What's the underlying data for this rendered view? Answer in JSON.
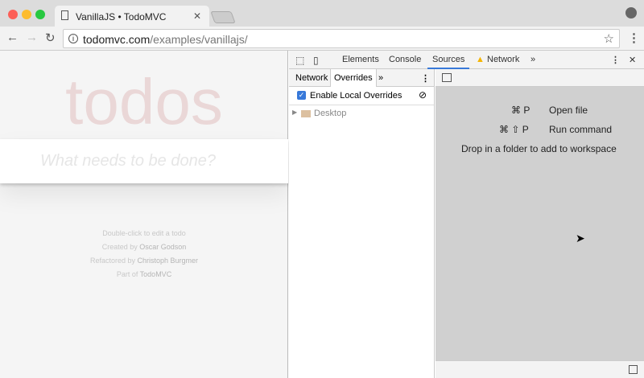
{
  "browser": {
    "tab_title": "VanillaJS • TodoMVC",
    "url_host": "todomvc.com",
    "url_path": "/examples/vanillajs/"
  },
  "page": {
    "heading": "todos",
    "placeholder": "What needs to be done?",
    "footer": {
      "hint": "Double-click to edit a todo",
      "created_prefix": "Created by ",
      "created_by": "Oscar Godson",
      "refactored_prefix": "Refactored by ",
      "refactored_by": "Christoph Burgmer",
      "part_prefix": "Part of ",
      "part_of": "TodoMVC"
    }
  },
  "devtools": {
    "tabs": [
      "Elements",
      "Console",
      "Sources",
      "Network"
    ],
    "active_tab": "Sources",
    "more": "»",
    "subtabs": [
      "Network",
      "Overrides"
    ],
    "active_subtab": "Overrides",
    "enable_overrides": "Enable Local Overrides",
    "enable_overrides_checked": true,
    "folder": "Desktop",
    "shortcuts": [
      {
        "keys": "⌘ P",
        "label": "Open file"
      },
      {
        "keys": "⌘ ⇧ P",
        "label": "Run command"
      }
    ],
    "drop_hint": "Drop in a folder to add to workspace"
  },
  "colors": {
    "accent": "#3879d9",
    "warning": "#f4b400"
  }
}
